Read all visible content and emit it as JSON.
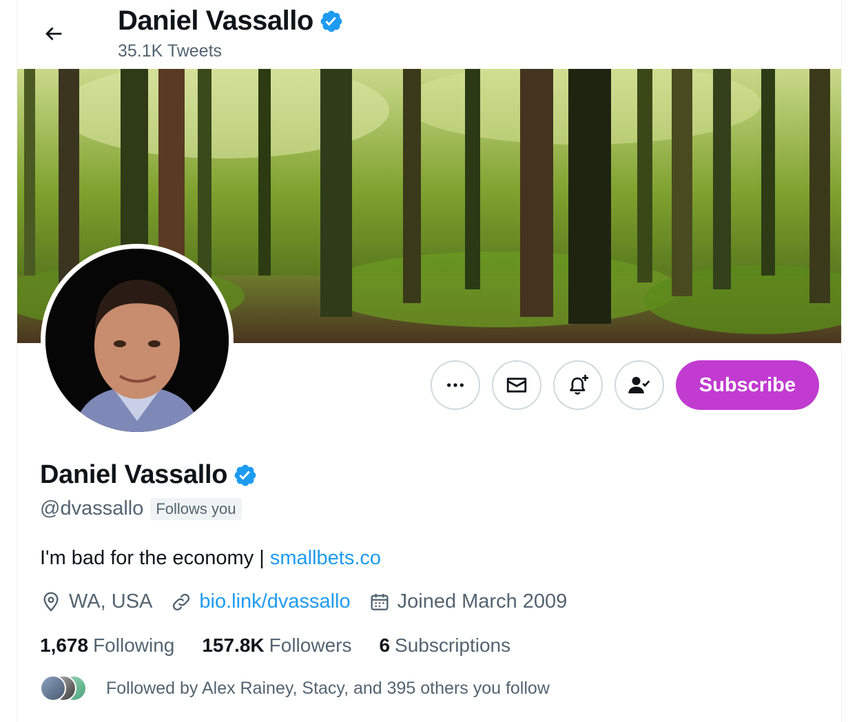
{
  "header": {
    "back_icon": "arrow-left-icon",
    "name": "Daniel Vassallo",
    "tweet_count": "35.1K Tweets"
  },
  "colors": {
    "verified": "#1d9bf0",
    "link": "#1d9bf0",
    "subscribe_bg": "#c13bd0",
    "secondary_text": "#536471"
  },
  "actions": {
    "more_icon": "more-dots-icon",
    "message_icon": "envelope-icon",
    "notify_icon": "bell-plus-icon",
    "following_icon": "person-check-icon",
    "subscribe_label": "Subscribe"
  },
  "profile": {
    "name": "Daniel Vassallo",
    "handle": "@dvassallo",
    "follows_you": "Follows you",
    "bio_text": "I'm bad for the economy | ",
    "bio_link": "smallbets.co",
    "location": "WA, USA",
    "website": "bio.link/dvassallo",
    "joined": "Joined March 2009"
  },
  "stats": {
    "following_count": "1,678",
    "following_label": "Following",
    "followers_count": "157.8K",
    "followers_label": "Followers",
    "subscriptions_count": "6",
    "subscriptions_label": "Subscriptions"
  },
  "followed_by": "Followed by Alex Rainey, Stacy, and 395 others you follow"
}
